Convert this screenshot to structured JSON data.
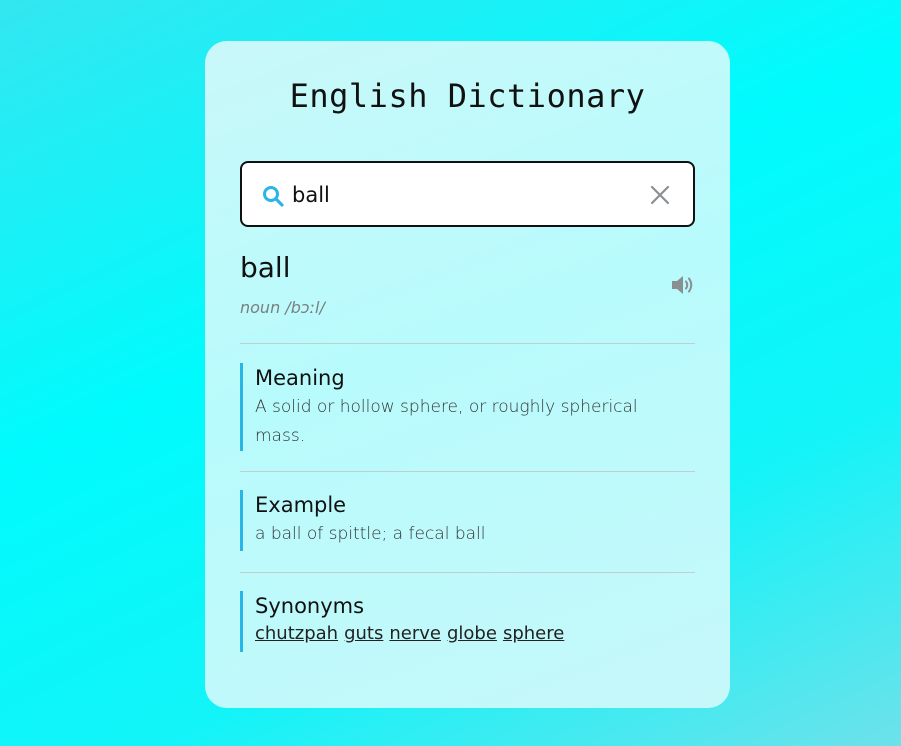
{
  "app": {
    "title": "English Dictionary"
  },
  "search": {
    "value": "ball",
    "placeholder": ""
  },
  "result": {
    "word": "ball",
    "phonetic": "noun /bɔːl/"
  },
  "sections": {
    "meaning": {
      "title": "Meaning",
      "text": "A solid or hollow sphere, or roughly spherical mass."
    },
    "example": {
      "title": "Example",
      "text": "a ball of spittle; a fecal ball"
    },
    "synonyms": {
      "title": "Synonyms",
      "items": [
        "chutzpah",
        "guts",
        "nerve",
        "globe",
        "sphere"
      ]
    }
  },
  "icons": {
    "search": "search-icon",
    "clear": "close-icon",
    "speaker": "speaker-icon"
  },
  "colors": {
    "accent": "#29b6e6",
    "icon_gray": "#8a8f92"
  }
}
